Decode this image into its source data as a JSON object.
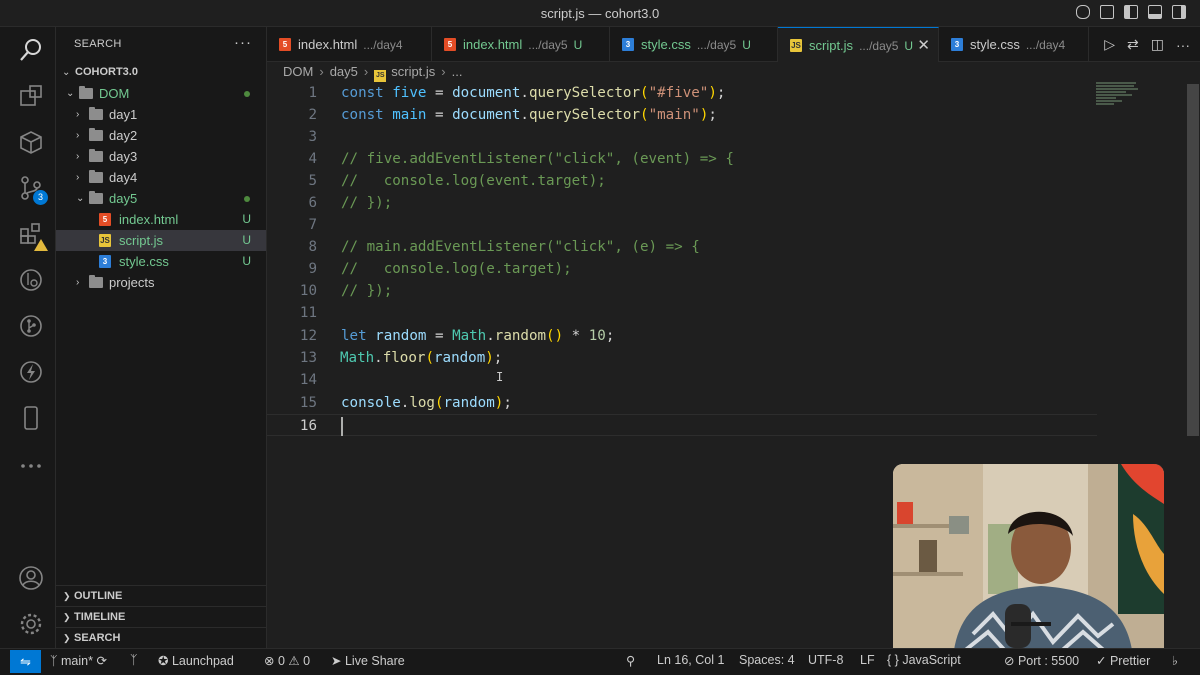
{
  "window": {
    "title": "script.js — cohort3.0"
  },
  "sidebar": {
    "header": "SEARCH",
    "root": "COHORT3.0",
    "tree": [
      {
        "label": "DOM",
        "depth": 0,
        "kind": "folder-open",
        "dot": true
      },
      {
        "label": "day1",
        "depth": 1,
        "kind": "folder"
      },
      {
        "label": "day2",
        "depth": 1,
        "kind": "folder"
      },
      {
        "label": "day3",
        "depth": 1,
        "kind": "folder"
      },
      {
        "label": "day4",
        "depth": 1,
        "kind": "folder"
      },
      {
        "label": "day5",
        "depth": 1,
        "kind": "folder-open",
        "dot": true
      },
      {
        "label": "index.html",
        "depth": 2,
        "kind": "html",
        "status": "U"
      },
      {
        "label": "script.js",
        "depth": 2,
        "kind": "js",
        "status": "U",
        "selected": true
      },
      {
        "label": "style.css",
        "depth": 2,
        "kind": "css",
        "status": "U"
      },
      {
        "label": "projects",
        "depth": 1,
        "kind": "folder-link"
      }
    ],
    "sections": [
      "OUTLINE",
      "TIMELINE",
      "SEARCH"
    ]
  },
  "activity_bar": {
    "icons": [
      "search-icon",
      "remote-explorer-icon",
      "extensions-box-icon",
      "source-control-icon",
      "extensions-icon",
      "git-lens-icon",
      "git-graph-icon",
      "thunder-client-icon",
      "device-icon",
      "more-icon",
      "account-icon",
      "settings-gear-icon"
    ],
    "source_control_badge": "3"
  },
  "tabs": [
    {
      "name": "index.html",
      "path": ".../day4",
      "icon": "html",
      "modified": "",
      "active": false
    },
    {
      "name": "index.html",
      "path": ".../day5",
      "icon": "html",
      "modified": "U",
      "active": false
    },
    {
      "name": "style.css",
      "path": ".../day5",
      "icon": "css",
      "modified": "U",
      "active": false
    },
    {
      "name": "script.js",
      "path": ".../day5",
      "icon": "js",
      "modified": "U",
      "active": true
    },
    {
      "name": "style.css",
      "path": ".../day4",
      "icon": "css",
      "modified": "",
      "active": false
    }
  ],
  "breadcrumb": [
    "DOM",
    "day5",
    "script.js",
    "..."
  ],
  "code": {
    "line_numbers": [
      "1",
      "2",
      "3",
      "4",
      "5",
      "6",
      "7",
      "8",
      "9",
      "10",
      "11",
      "12",
      "13",
      "14",
      "15",
      "16"
    ],
    "current_line": "16"
  },
  "statusbar": {
    "branch": "main*",
    "launchpad": "Launchpad",
    "errors": "0",
    "warnings": "0",
    "live_share": "Live Share",
    "position": "Ln 16, Col 1",
    "spaces": "Spaces: 4",
    "encoding": "UTF-8",
    "eol": "LF",
    "language": "JavaScript",
    "port": "Port : 5500",
    "prettier": "Prettier"
  },
  "colors": {
    "accent": "#0078d4",
    "untracked": "#73c991",
    "keyword": "#569cd6",
    "string": "#ce9178",
    "comment": "#6a9955"
  }
}
